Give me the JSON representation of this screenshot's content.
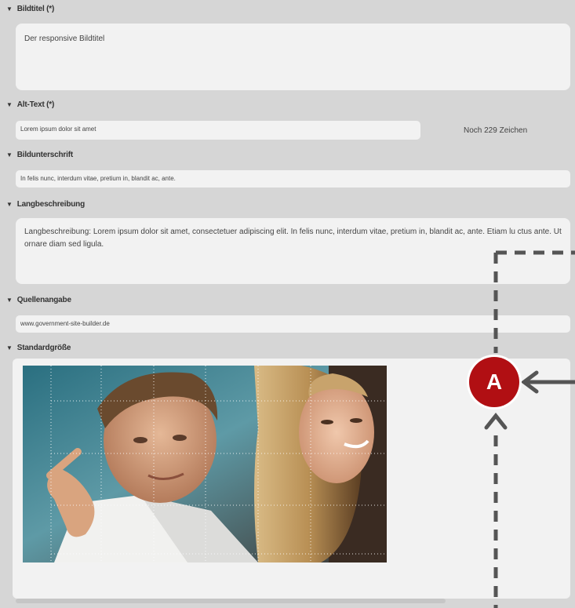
{
  "sections": {
    "bildtitel": {
      "label": "Bildtitel (*)",
      "value": "Der responsive Bildtitel"
    },
    "alttext": {
      "label": "Alt-Text (*)",
      "value": "Lorem ipsum dolor sit amet",
      "counter": "Noch 229 Zeichen"
    },
    "bildunterschrift": {
      "label": "Bildunterschrift",
      "value": "In felis nunc, interdum vitae, pretium in, blandit ac, ante."
    },
    "langbeschreibung": {
      "label": "Langbeschreibung",
      "value": "Langbeschreibung: Lorem ipsum dolor sit amet, consectetuer adipiscing elit. In felis nunc, interdum vitae, pretium in, blandit ac, ante. Etiam lu ctus ante. Ut ornare diam sed ligula."
    },
    "quellenangabe": {
      "label": "Quellenangabe",
      "value": "www.government-site-builder.de"
    },
    "standardgroesse": {
      "label": "Standardgröße"
    }
  },
  "callout": {
    "letter": "A"
  },
  "colors": {
    "callout": "#b10f13",
    "field_bg": "#f2f2f2",
    "panel_bg": "#d6d6d6"
  },
  "icons": [
    "triangle-down-icon",
    "arrow-left-icon",
    "arrow-up-icon"
  ]
}
